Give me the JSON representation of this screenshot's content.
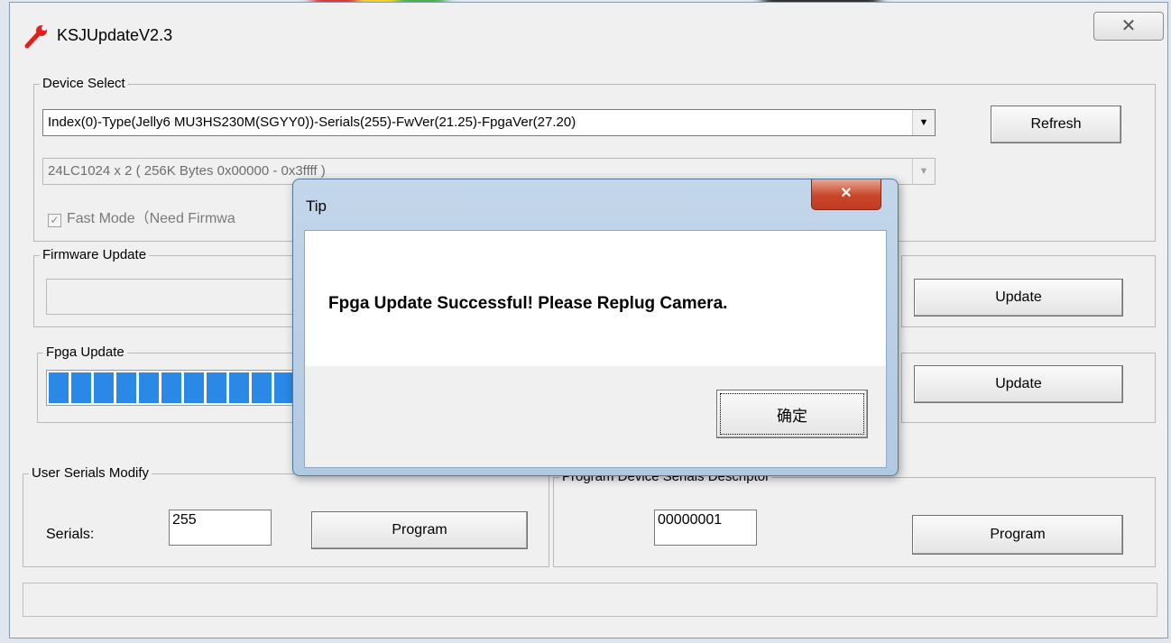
{
  "window": {
    "title": "KSJUpdateV2.3",
    "close_glyph": "✕"
  },
  "device_select": {
    "label": "Device Select",
    "device_combo": "Index(0)-Type(Jelly6 MU3HS230M(SGYY0))-Serials(255)-FwVer(21.25)-FpgaVer(27.20)",
    "eeprom_combo": "24LC1024 x 2 ( 256K Bytes 0x00000 - 0x3ffff )",
    "refresh_label": "Refresh",
    "fast_mode_label": "Fast Mode（Need Firmwa",
    "fast_mode_checked": true
  },
  "firmware_update": {
    "label": "Firmware Update",
    "update_label": "Update"
  },
  "fpga_update": {
    "label": "Fpga Update",
    "update_label": "Update",
    "progress_blocks": 11
  },
  "user_serials": {
    "label": "User Serials Modify",
    "serials_label": "Serials:",
    "serials_value": "255",
    "program_label": "Program"
  },
  "device_serials": {
    "label": "Program Device Serials Descriptor",
    "value": "00000001",
    "program_label": "Program"
  },
  "dialog": {
    "title": "Tip",
    "close_glyph": "✕",
    "message": "Fpga Update Successful! Please Replug Camera.",
    "ok_label": "确定"
  },
  "icons": {
    "app": "wrench-icon",
    "close": "close-icon",
    "dropdown": "chevron-down-icon"
  },
  "colors": {
    "progress": "#2a88e6",
    "dialog_close": "#c9452a"
  }
}
